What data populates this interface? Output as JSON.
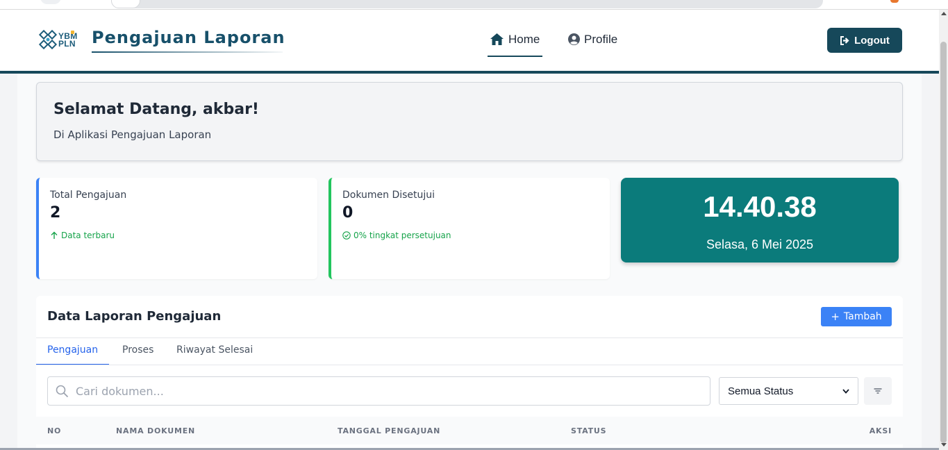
{
  "brand": {
    "logo_line1": "YBM",
    "logo_line2": "PLN",
    "title": "Pengajuan Laporan"
  },
  "nav": {
    "home_label": "Home",
    "profile_label": "Profile",
    "logout_label": "Logout"
  },
  "welcome": {
    "heading": "Selamat Datang, akbar!",
    "subtext": "Di Aplikasi Pengajuan Laporan"
  },
  "stats": [
    {
      "label": "Total Pengajuan",
      "value": "2",
      "note": "Data terbaru"
    },
    {
      "label": "Dokumen Disetujui",
      "value": "0",
      "note": "0% tingkat persetujuan"
    }
  ],
  "clock": {
    "time": "14.40.38",
    "date": "Selasa, 6 Mei 2025"
  },
  "table_panel": {
    "title": "Data Laporan Pengajuan",
    "add_label": "Tambah",
    "tabs": [
      "Pengajuan",
      "Proses",
      "Riwayat Selesai"
    ],
    "active_tab": "Pengajuan",
    "search_placeholder": "Cari dokumen...",
    "status_selected": "Semua Status",
    "columns": [
      "NO",
      "NAMA DOKUMEN",
      "TANGGAL PENGAJUAN",
      "STATUS",
      "AKSI"
    ]
  },
  "colors": {
    "primary": "#16485a",
    "clock_bg": "#0b7b7b",
    "accent_blue": "#3b82f6",
    "accent_green": "#22c55e"
  },
  "icons": {
    "home": "home-icon",
    "profile": "user-circle-icon",
    "logout": "logout-icon",
    "trend": "arrow-up-icon",
    "check": "check-circle-icon",
    "search": "search-icon",
    "filter": "filter-icon"
  }
}
